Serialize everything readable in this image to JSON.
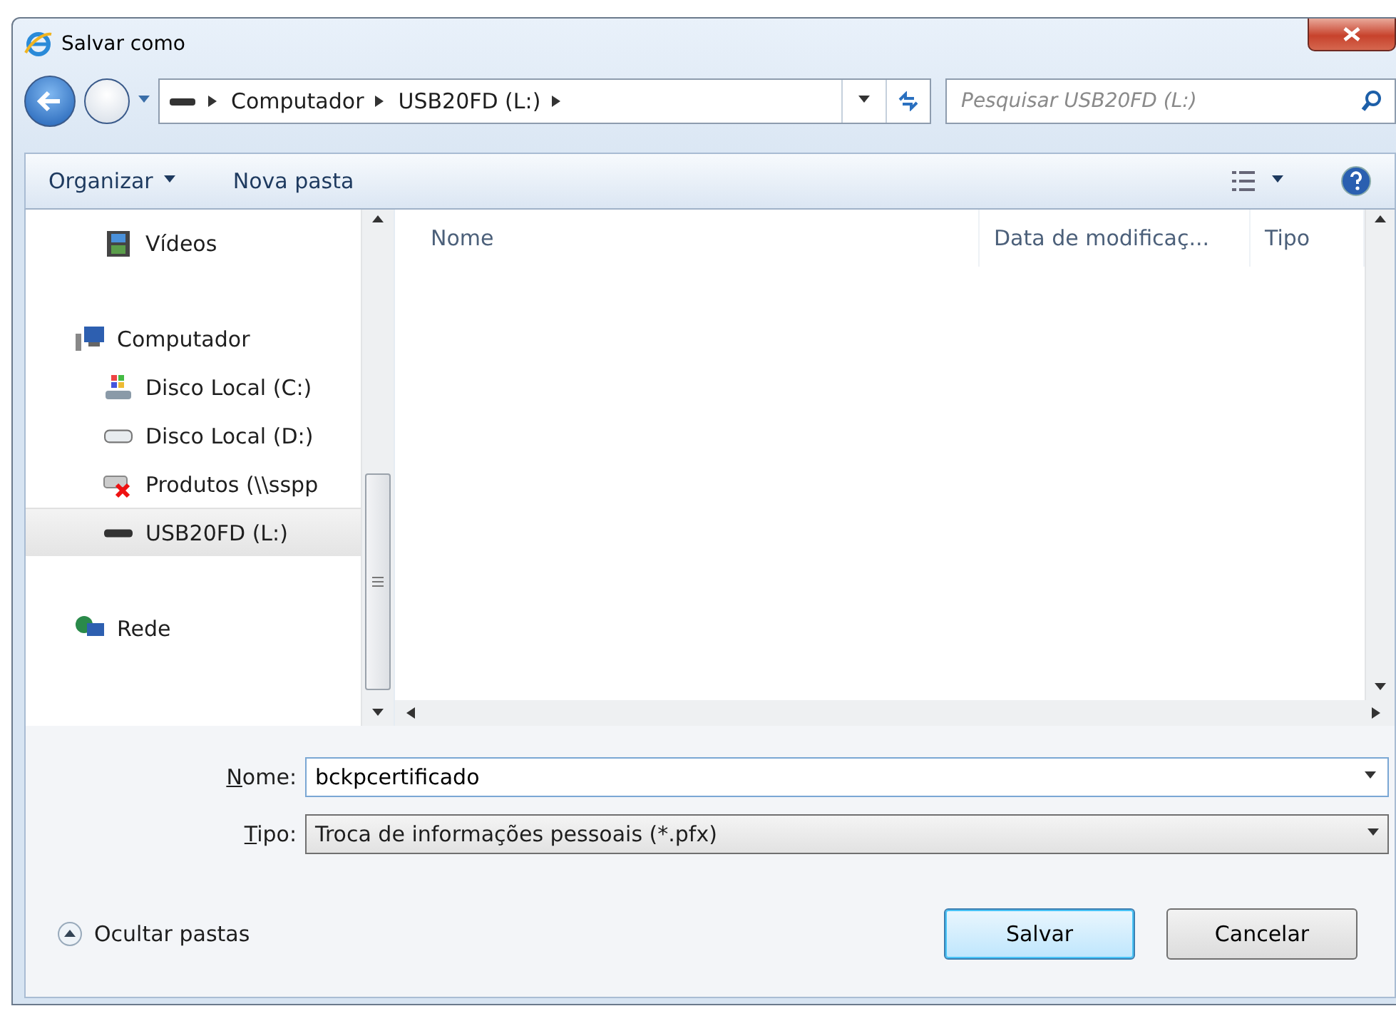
{
  "window": {
    "title": "Salvar como"
  },
  "address_bar": {
    "crumbs": [
      "Computador",
      "USB20FD (L:)"
    ]
  },
  "search": {
    "placeholder": "Pesquisar USB20FD (L:)"
  },
  "toolbar": {
    "organize": "Organizar",
    "new_folder": "Nova pasta"
  },
  "sidebar": {
    "items": [
      {
        "children": [
          {
            "label": "Vídeos",
            "kind": "videos",
            "selected": false
          }
        ]
      },
      {
        "label": "Computador",
        "kind": "computer",
        "selected": false,
        "children": [
          {
            "label": "Disco Local (C:)",
            "kind": "system-drive",
            "selected": false
          },
          {
            "label": "Disco Local (D:)",
            "kind": "drive",
            "selected": false
          },
          {
            "label": "Produtos (\\\\sspp",
            "kind": "network-drive",
            "selected": false
          },
          {
            "label": "USB20FD (L:)",
            "kind": "usb-drive",
            "selected": true
          }
        ]
      },
      {
        "label": "Rede",
        "kind": "network",
        "selected": false
      }
    ]
  },
  "table": {
    "columns": [
      "Nome",
      "Data de modificaç...",
      "Tipo"
    ]
  },
  "name_field": {
    "label": "Nome:",
    "value": "bckpcertificado"
  },
  "type_field": {
    "label": "Tipo:",
    "value": "Troca de informações pessoais (*.pfx)"
  },
  "hide_folders": "Ocultar pastas",
  "buttons": [
    {
      "label": "Salvar",
      "default": true
    },
    {
      "label": "Cancelar",
      "default": false
    }
  ]
}
